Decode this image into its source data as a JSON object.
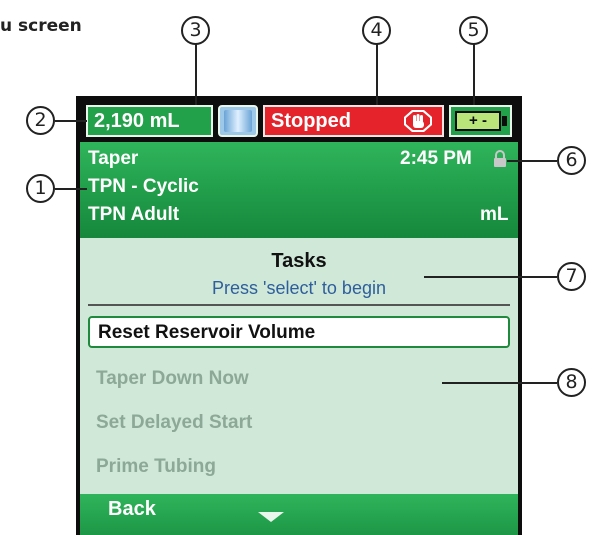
{
  "caption": "u screen",
  "callouts": [
    "1",
    "2",
    "3",
    "4",
    "5",
    "6",
    "7",
    "8"
  ],
  "status": {
    "volume": "2,190 mL",
    "state": "Stopped",
    "battery": "+ -"
  },
  "info": {
    "mode": "Taper",
    "time": "2:45 PM",
    "program": "TPN - Cyclic",
    "therapy": "TPN Adult",
    "unit": "mL"
  },
  "menu": {
    "title": "Tasks",
    "hint": "Press 'select' to begin",
    "items": [
      {
        "label": "Reset Reservoir Volume",
        "selected": true
      },
      {
        "label": "Taper Down Now",
        "selected": false
      },
      {
        "label": "Set Delayed Start",
        "selected": false
      },
      {
        "label": "Prime Tubing",
        "selected": false
      }
    ]
  },
  "footer": {
    "back_label": "Back"
  },
  "colors": {
    "green": "#22a04a",
    "red": "#e4242a",
    "content_bg": "#cfe8d8",
    "hint_blue": "#2f5e9c"
  }
}
